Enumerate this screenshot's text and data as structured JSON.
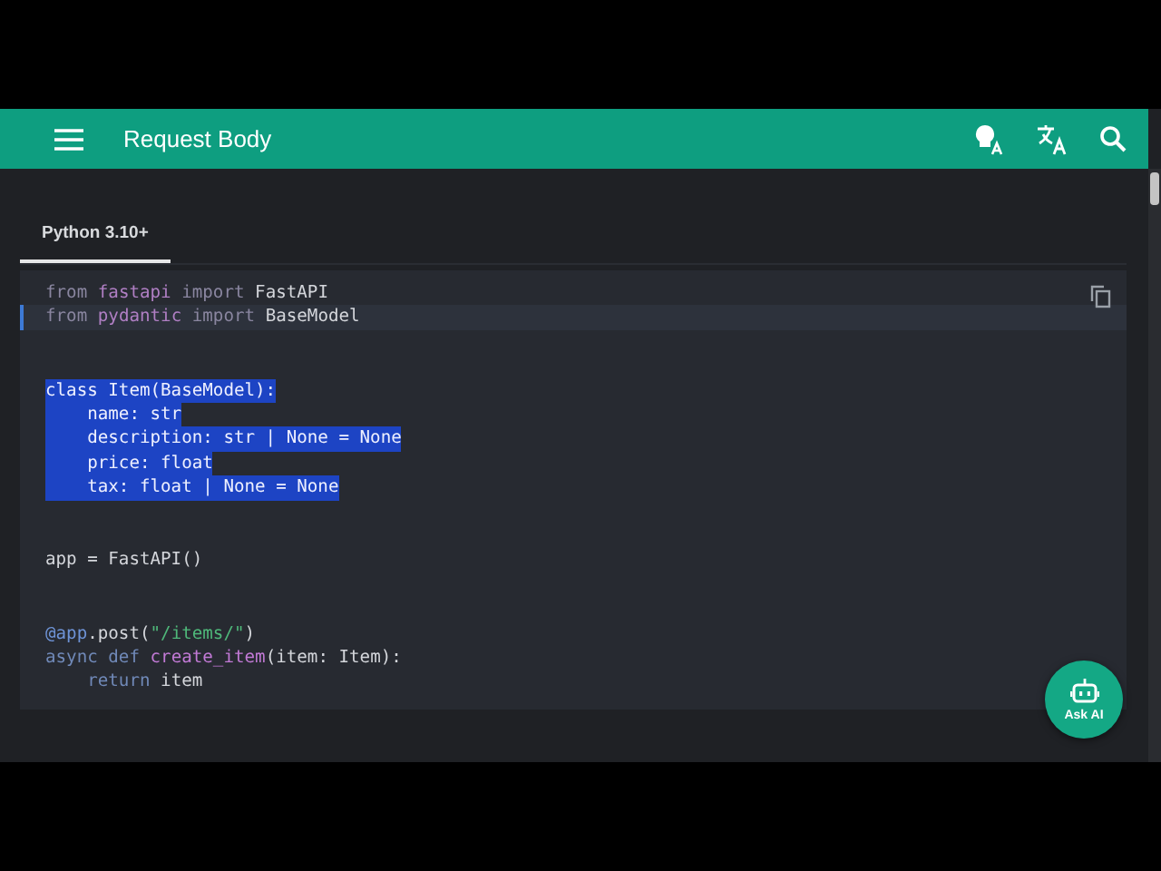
{
  "header": {
    "title": "Request Body"
  },
  "tabs": [
    {
      "label": "Python 3.10+",
      "selected": true
    }
  ],
  "code": {
    "blocks": [
      {
        "lines": [
          {
            "selected": false,
            "current": false,
            "tokens": [
              {
                "text": "from ",
                "kind": "keyword"
              },
              {
                "text": "fastapi ",
                "kind": "module"
              },
              {
                "text": "import ",
                "kind": "keyword"
              },
              {
                "text": "FastAPI",
                "kind": "plain"
              }
            ]
          },
          {
            "selected": false,
            "current": true,
            "tokens": [
              {
                "text": "from ",
                "kind": "keyword"
              },
              {
                "text": "pydantic ",
                "kind": "module"
              },
              {
                "text": "import ",
                "kind": "keyword"
              },
              {
                "text": "BaseModel",
                "kind": "plain"
              }
            ]
          }
        ]
      },
      {
        "lines": [
          {
            "selected": true,
            "current": false,
            "tokens": [
              {
                "text": "class Item(BaseModel):",
                "kind": "plain"
              }
            ]
          },
          {
            "selected": true,
            "current": false,
            "tokens": [
              {
                "text": "    name: str",
                "kind": "plain"
              }
            ]
          },
          {
            "selected": true,
            "current": false,
            "tokens": [
              {
                "text": "    description: str | None = None",
                "kind": "plain"
              }
            ]
          },
          {
            "selected": true,
            "current": false,
            "tokens": [
              {
                "text": "    price: float",
                "kind": "plain"
              }
            ]
          },
          {
            "selected": true,
            "current": false,
            "tokens": [
              {
                "text": "    tax: float | None = None",
                "kind": "plain"
              }
            ]
          }
        ]
      },
      {
        "lines": [
          {
            "selected": false,
            "current": false,
            "tokens": [
              {
                "text": "app = FastAPI()",
                "kind": "plain"
              }
            ]
          }
        ]
      },
      {
        "lines": [
          {
            "selected": false,
            "current": false,
            "tokens": [
              {
                "text": "@app",
                "kind": "decorator"
              },
              {
                "text": ".post(",
                "kind": "plain"
              },
              {
                "text": "\"/items/\"",
                "kind": "string"
              },
              {
                "text": ")",
                "kind": "plain"
              }
            ]
          },
          {
            "selected": false,
            "current": false,
            "tokens": [
              {
                "text": "async def ",
                "kind": "keyword2"
              },
              {
                "text": "create_item",
                "kind": "function"
              },
              {
                "text": "(item: Item):",
                "kind": "plain"
              }
            ]
          },
          {
            "selected": false,
            "current": false,
            "tokens": [
              {
                "text": "    return ",
                "kind": "keyword2"
              },
              {
                "text": "item",
                "kind": "plain"
              }
            ]
          }
        ]
      }
    ]
  },
  "ask_ai": {
    "label": "Ask AI"
  }
}
